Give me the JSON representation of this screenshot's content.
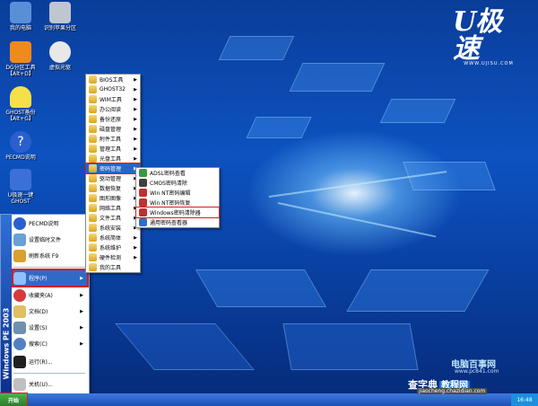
{
  "desktop": {
    "icons": [
      {
        "label": "我的电脑",
        "icon": "computer-icon",
        "color": "#5a8fd8"
      },
      {
        "label": "识别苹果分区",
        "icon": "apple-drive-icon",
        "color": "#c0c6cf"
      },
      {
        "label": "DG分区工具\n【Alt+D】",
        "icon": "diskgenius-icon",
        "color": "#f08a1a"
      },
      {
        "label": "虚拟光驱",
        "icon": "virtual-cd-icon",
        "color": "#e8e8e8"
      },
      {
        "label": "GHOST备份\n【Alt+G】",
        "icon": "ghost-icon",
        "color": "#f5e04a"
      },
      {
        "label": "PECMD说明",
        "icon": "help-icon",
        "color": "#2a5fd0"
      },
      {
        "label": "U极速一键\nGHOST",
        "icon": "ghost-restore-icon",
        "color": "#3a70d8"
      }
    ],
    "brand": {
      "logo_text": "U极速",
      "url_text": "WWW.UJISU.COM"
    }
  },
  "start_menu": {
    "side_title": "Windows PE 2003",
    "items": [
      {
        "label": "PECMD说明",
        "icon": "help-icon",
        "color": "#2a5fd0"
      },
      {
        "label": "设置临时文件",
        "icon": "settings-file-icon",
        "color": "#6aa0d8"
      },
      {
        "label": "刷新系统 F9",
        "icon": "refresh-icon",
        "color": "#d8a030"
      },
      {
        "label": "程序(P)",
        "icon": "programs-icon",
        "color": "#3a70d8"
      },
      {
        "label": "收藏夹(A)",
        "icon": "favorites-icon",
        "color": "#d83a3a"
      },
      {
        "label": "文档(D)",
        "icon": "documents-icon",
        "color": "#e0c060"
      },
      {
        "label": "设置(S)",
        "icon": "settings-icon",
        "color": "#7090b0"
      },
      {
        "label": "搜索(C)",
        "icon": "search-icon",
        "color": "#5080c0"
      },
      {
        "label": "运行(R)...",
        "icon": "run-icon",
        "color": "#202020"
      },
      {
        "label": "关机(U)...",
        "icon": "shutdown-icon",
        "color": "#c0c0c0"
      }
    ]
  },
  "programs_menu": {
    "items": [
      "BIOS工具",
      "GHOST32",
      "WIM工具",
      "办公阅读",
      "备份还原",
      "磁盘管理",
      "附件工具",
      "管理工具",
      "光盘工具",
      "密码管理",
      "驱动管理",
      "数据恢复",
      "图形图像",
      "网络工具",
      "文件工具",
      "系统安装",
      "系统简体",
      "系统维护",
      "硬件检测",
      "我的工具"
    ],
    "highlighted_index": 9
  },
  "password_menu": {
    "items": [
      {
        "label": "ADSL密码查看",
        "icon": "adsl-icon",
        "color": "#3a9a3a"
      },
      {
        "label": "CMOS密码清除",
        "icon": "cmos-icon",
        "color": "#404040"
      },
      {
        "label": "Win NT密码编辑",
        "icon": "nt-edit-icon",
        "color": "#c03030"
      },
      {
        "label": "Win NT密码恢复",
        "icon": "nt-recover-icon",
        "color": "#c03030"
      },
      {
        "label": "Windows密码清除器",
        "icon": "password-cleaner-icon",
        "color": "#c03030"
      },
      {
        "label": "通用密码查看器",
        "icon": "password-viewer-icon",
        "color": "#3070c0"
      }
    ],
    "boxed_index": 4
  },
  "taskbar": {
    "start_label": "开始",
    "clock": "16:48"
  },
  "watermark": {
    "line1": "电脑百事网",
    "line2": "www.pc841.com",
    "line3a": "查字典",
    "line3b": "教程网",
    "line4": "jiaocheng.chazidian.com"
  },
  "colors": {
    "highlight": "#2b63c5",
    "outline": "#d21e1e",
    "taskbar": "#2a62c8"
  }
}
